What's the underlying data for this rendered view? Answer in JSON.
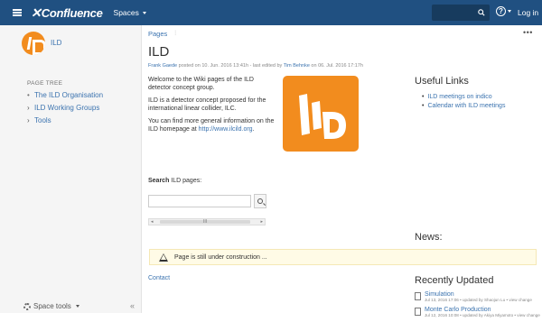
{
  "topbar": {
    "brand": "Confluence",
    "spaces_label": "Spaces",
    "login_label": "Log in",
    "help_glyph": "?"
  },
  "sidebar": {
    "space_name": "ILD",
    "page_tree_label": "PAGE TREE",
    "items": [
      {
        "label": "The ILD Organisation",
        "marker": "•"
      },
      {
        "label": "ILD Working Groups",
        "marker": "›"
      },
      {
        "label": "Tools",
        "marker": "›"
      }
    ],
    "space_tools_label": "Space tools",
    "collapse_glyph": "«"
  },
  "breadcrumb": {
    "label": "Pages"
  },
  "page": {
    "title": "ILD",
    "byline": {
      "author": "Frank Gaede",
      "posted": " posted on 10. Jun. 2016 13:41h - last edited by ",
      "editor": "Tim Behnke",
      "edited": " on 06. Jul. 2016 17:17h"
    },
    "paragraphs": [
      "Welcome to the Wiki pages of the ILD detector concept group.",
      "ILD is a detector concept proposed for the international linear collider, ILC."
    ],
    "link_intro": "You can find more general information on the ILD homepage at ",
    "link_url": "http://www.ilcild.org",
    "link_end": "."
  },
  "search": {
    "label_bold": "Search",
    "label_rest": " ILD pages:",
    "placeholder": ""
  },
  "scroll_grip": "III",
  "useful_links": {
    "title": "Useful Links",
    "items": [
      "ILD meetings on indico",
      "Calendar with ILD meetings"
    ]
  },
  "news": {
    "title": "News:"
  },
  "warning": {
    "text": "Page is still under construction ..."
  },
  "contact_label": "Contact",
  "recently_updated": {
    "title": "Recently Updated",
    "items": [
      {
        "name": "Simulation",
        "meta": "Jul 13, 2016 17:06 • updated by Shaojun Lu • view change"
      },
      {
        "name": "Monte Carlo Production",
        "meta": "Jul 12, 2016 10:08 • updated by Akiya Miyamoto • view change"
      }
    ]
  },
  "colors": {
    "topbar": "#205081",
    "link": "#3b73af",
    "brand_orange": "#f28c1e",
    "warning_bg": "#fffbe6"
  },
  "icons": [
    "menu-icon",
    "confluence-logo-icon",
    "search-icon",
    "help-icon",
    "pin-icon",
    "more-icon",
    "gear-icon",
    "warning-icon",
    "page-icon"
  ]
}
